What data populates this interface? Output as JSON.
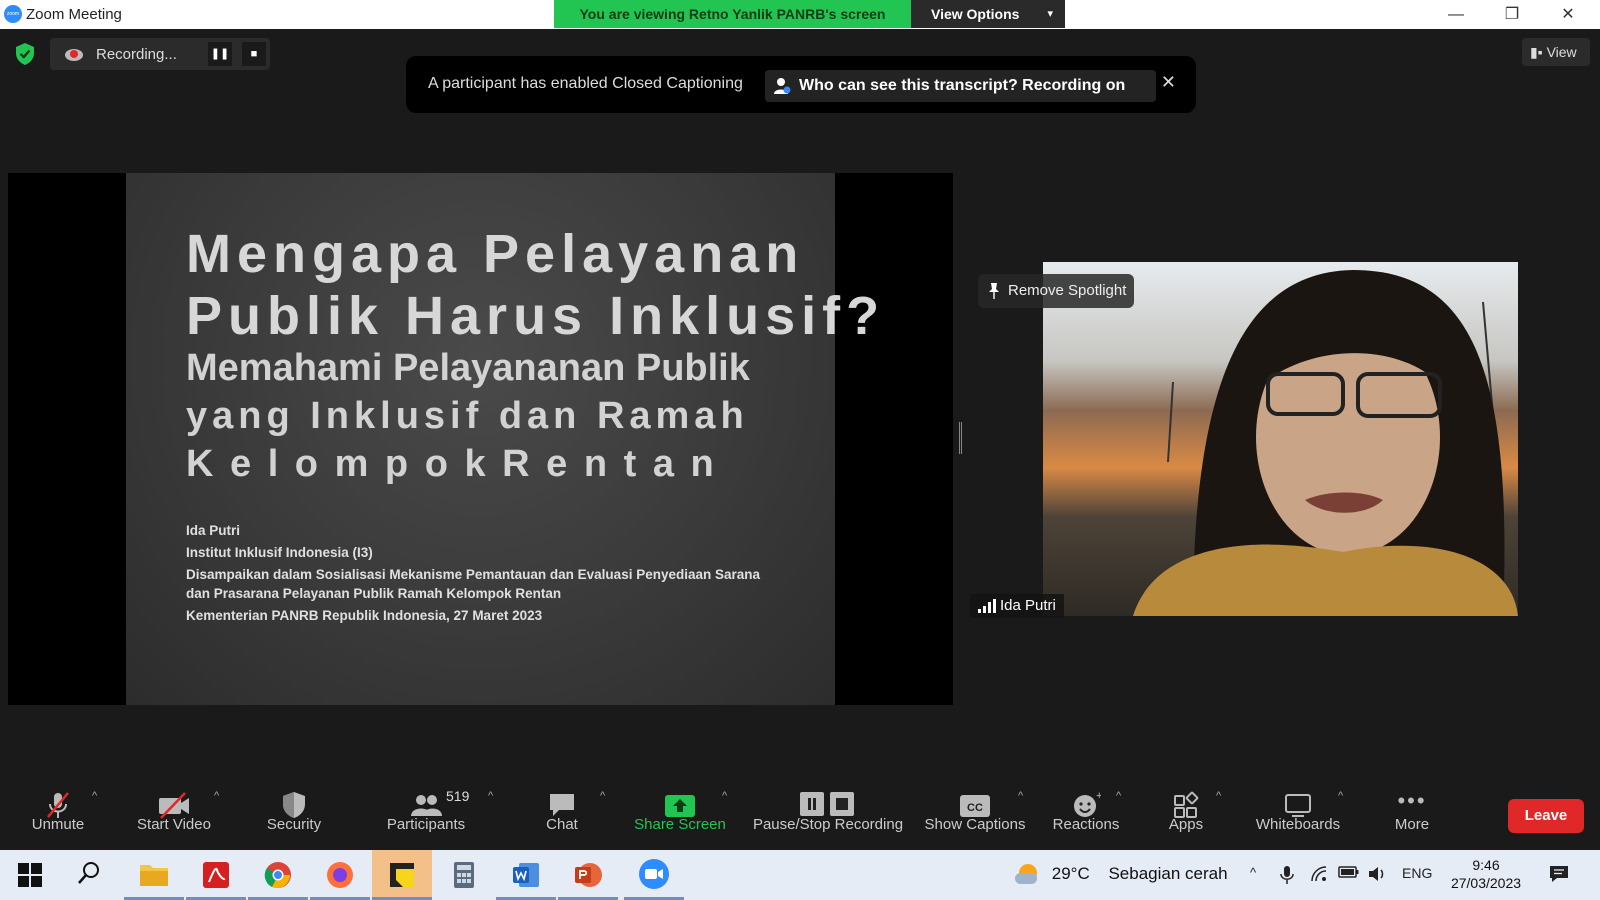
{
  "window": {
    "title": "Zoom Meeting",
    "app_icon_text": "zoom",
    "controls": {
      "minimize": "—",
      "restore": "❐",
      "close": "✕"
    }
  },
  "share_banner": {
    "text": "You are viewing Retno Yanlik PANRB's screen",
    "view_options": "View Options"
  },
  "recording": {
    "label": "Recording...",
    "pause": "❚❚",
    "stop": "■"
  },
  "view_button": "View",
  "caption_banner": {
    "message": "A participant has enabled Closed Captioning",
    "who_button": "Who can see this transcript? Recording on",
    "close": "✕"
  },
  "slide": {
    "title_line1": "Mengapa Pelayanan",
    "title_line2": "Publik Harus Inklusif?",
    "subtitle_line1": "Memahami Pelayananan Publik",
    "subtitle_line2": "yang Inklusif dan Ramah",
    "subtitle_line3": "K e l o m p o k   R e n t a n",
    "presenter": "Ida Putri",
    "institution": "Institut Inklusif Indonesia (I3)",
    "event_line1": "Disampaikan dalam Sosialisasi Mekanisme Pemantauan dan Evaluasi Penyediaan Sarana",
    "event_line2": "dan Prasarana Pelayanan Publik Ramah Kelompok Rentan",
    "venue": "Kementerian PANRB Republik Indonesia, 27 Maret 2023"
  },
  "video": {
    "spotlight_button": "Remove Spotlight",
    "participant_name": "Ida Putri"
  },
  "toolbar": {
    "unmute": "Unmute",
    "start_video": "Start Video",
    "security": "Security",
    "participants": "Participants",
    "participant_count": "519",
    "chat": "Chat",
    "share_screen": "Share Screen",
    "pause_stop_recording": "Pause/Stop Recording",
    "show_captions": "Show Captions",
    "cc_glyph": "CC",
    "reactions": "Reactions",
    "apps": "Apps",
    "whiteboards": "Whiteboards",
    "more": "More",
    "more_glyph": "•••",
    "leave": "Leave",
    "caret": "^"
  },
  "taskbar": {
    "weather_temp": "29°C",
    "weather_text": "Sebagian cerah",
    "language": "ENG",
    "time": "9:46",
    "date": "27/03/2023",
    "tray_caret": "^"
  },
  "colors": {
    "share_green": "#23c552",
    "leave_red": "#e02828",
    "toolbar_bg": "#1a1a1a",
    "taskbar_bg": "#e6ecf5",
    "zoom_blue": "#2d8cff"
  }
}
